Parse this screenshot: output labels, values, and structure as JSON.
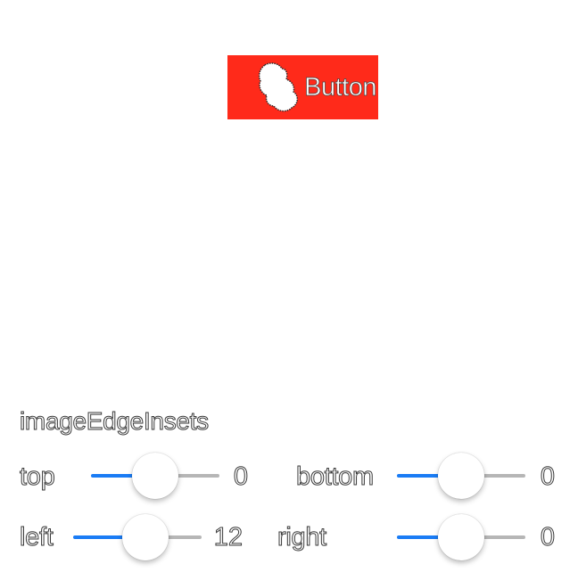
{
  "demo_button": {
    "title": "Button",
    "background_color": "#FF2A1A",
    "image_icon": "blob-image-icon"
  },
  "section_label": "imageEdgeInsets",
  "colors": {
    "slider_min_track": "#1A7CF5",
    "slider_max_track": "#B6B6B6"
  },
  "sliders": {
    "top": {
      "label": "top",
      "value": "0",
      "fill_fraction": 0.5
    },
    "bottom": {
      "label": "bottom",
      "value": "0",
      "fill_fraction": 0.5
    },
    "left": {
      "label": "left",
      "value": "12",
      "fill_fraction": 0.6
    },
    "right": {
      "label": "right",
      "value": "0",
      "fill_fraction": 0.5
    }
  }
}
